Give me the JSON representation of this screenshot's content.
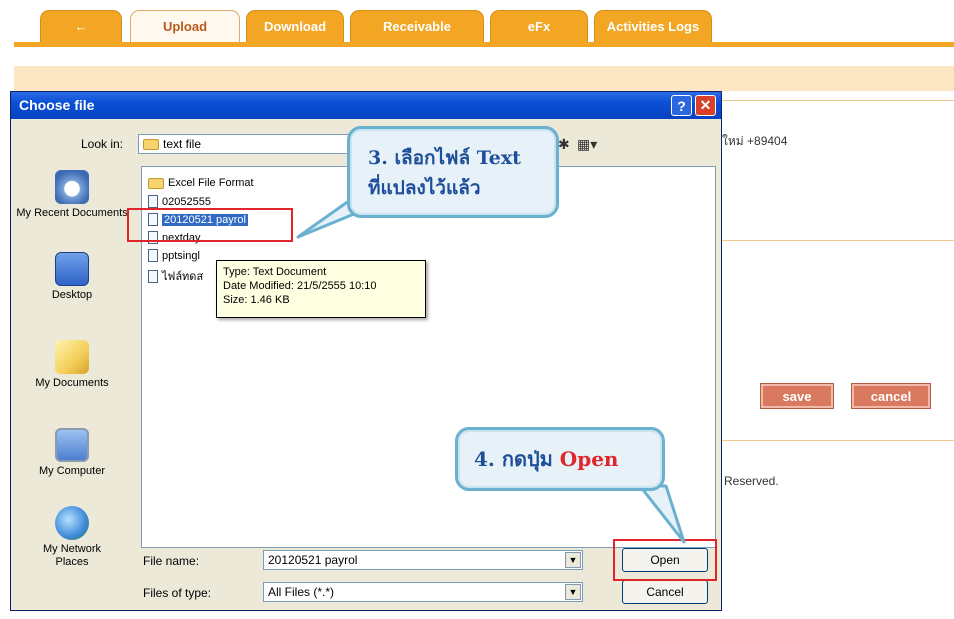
{
  "web": {
    "tabs": [
      {
        "label": "←"
      },
      {
        "label": "Upload"
      },
      {
        "label": "Download"
      },
      {
        "label": "Receivable"
      },
      {
        "label": "eFx"
      },
      {
        "label": "Activities Logs"
      }
    ],
    "partial_text": "ใหม่ +89404",
    "save_label": "save",
    "cancel_label": "cancel",
    "footer_text": "Reserved."
  },
  "dialog": {
    "title": "Choose file",
    "help_label": "?",
    "close_label": "✕",
    "look_in_label": "Look in:",
    "look_in_value": "text file",
    "places": [
      {
        "label": "My Recent Documents",
        "icon": "recent-documents-icon"
      },
      {
        "label": "Desktop",
        "icon": "desktop-icon"
      },
      {
        "label": "My Documents",
        "icon": "my-documents-icon"
      },
      {
        "label": "My Computer",
        "icon": "my-computer-icon"
      },
      {
        "label": "My Network Places",
        "icon": "network-places-icon"
      }
    ],
    "files": [
      {
        "name": "Excel File Format",
        "type": "folder"
      },
      {
        "name": "02052555",
        "type": "text"
      },
      {
        "name": "20120521 payrol",
        "type": "text"
      },
      {
        "name": "nextday",
        "type": "text"
      },
      {
        "name": "pptsingl",
        "type": "text"
      },
      {
        "name": "ไฟล์ทดส",
        "type": "text"
      }
    ],
    "tooltip": {
      "type": "Type: Text Document",
      "modified": "Date Modified: 21/5/2555 10:10",
      "size": "Size: 1.46 KB"
    },
    "file_name_label": "File name:",
    "file_name_value": "20120521 payrol",
    "file_type_label": "Files of type:",
    "file_type_value": "All Files (*.*)",
    "open_label": "Open",
    "cancel_label": "Cancel"
  },
  "callouts": {
    "step3_line1_prefix": "3. เลือกไฟล์ ",
    "step3_line1_text": "Text",
    "step3_line2": "ที่แปลงไว้แล้ว",
    "step4_prefix": "4. กดปุ่ม ",
    "step4_open": "Open"
  },
  "colors": {
    "tab_orange": "#f2a623",
    "titlebar_blue": "#0a4fd6",
    "highlight_red": "#e0262b",
    "callout_border": "#6ab0cf",
    "selection_blue": "#316ac5"
  }
}
